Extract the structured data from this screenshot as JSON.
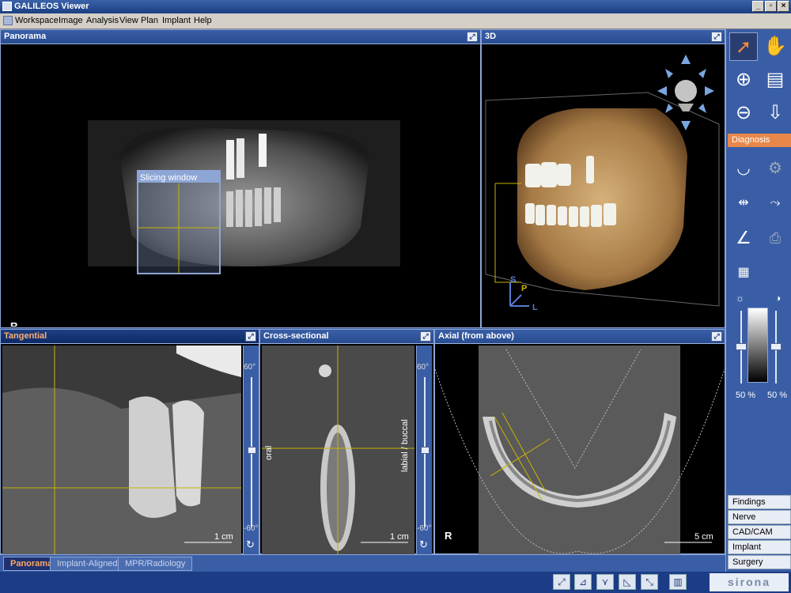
{
  "window": {
    "title": "GALILEOS Viewer"
  },
  "menu": [
    "Workspace",
    "Image",
    "Analysis",
    "View",
    "Plan",
    "Implant",
    "Help"
  ],
  "panels": {
    "panorama": {
      "title": "Panorama",
      "overlay_label": "Slicing window",
      "orientation": "R"
    },
    "view3d": {
      "title": "3D",
      "axis_s": "S",
      "axis_p": "P",
      "axis_l": "L"
    },
    "tangential": {
      "title": "Tangential",
      "scale": "1 cm",
      "deg_top": "60°",
      "deg_bottom": "-60°"
    },
    "cross_sectional": {
      "title": "Cross-sectional",
      "label_left": "oral",
      "label_right": "labial / buccal",
      "scale": "1 cm",
      "deg_top": "60°",
      "deg_bottom": "-60°"
    },
    "axial": {
      "title": "Axial (from above)",
      "orientation": "R",
      "scale": "5 cm"
    }
  },
  "toolbar": {
    "diagnosis_label": "Diagnosis",
    "brightness_value": "50 %",
    "contrast_value": "50 %",
    "side_buttons": [
      "Findings",
      "Nerve",
      "CAD/CAM",
      "Implant",
      "Surgery"
    ]
  },
  "tabs": [
    "Panorama",
    "Implant-Aligned",
    "MPR/Radiology"
  ],
  "branding": {
    "logo_text": "sirona"
  },
  "colors": {
    "accent_orange": "#e8874a",
    "panel_blue": "#3a5ea6",
    "crosshair": "#c8b400"
  }
}
